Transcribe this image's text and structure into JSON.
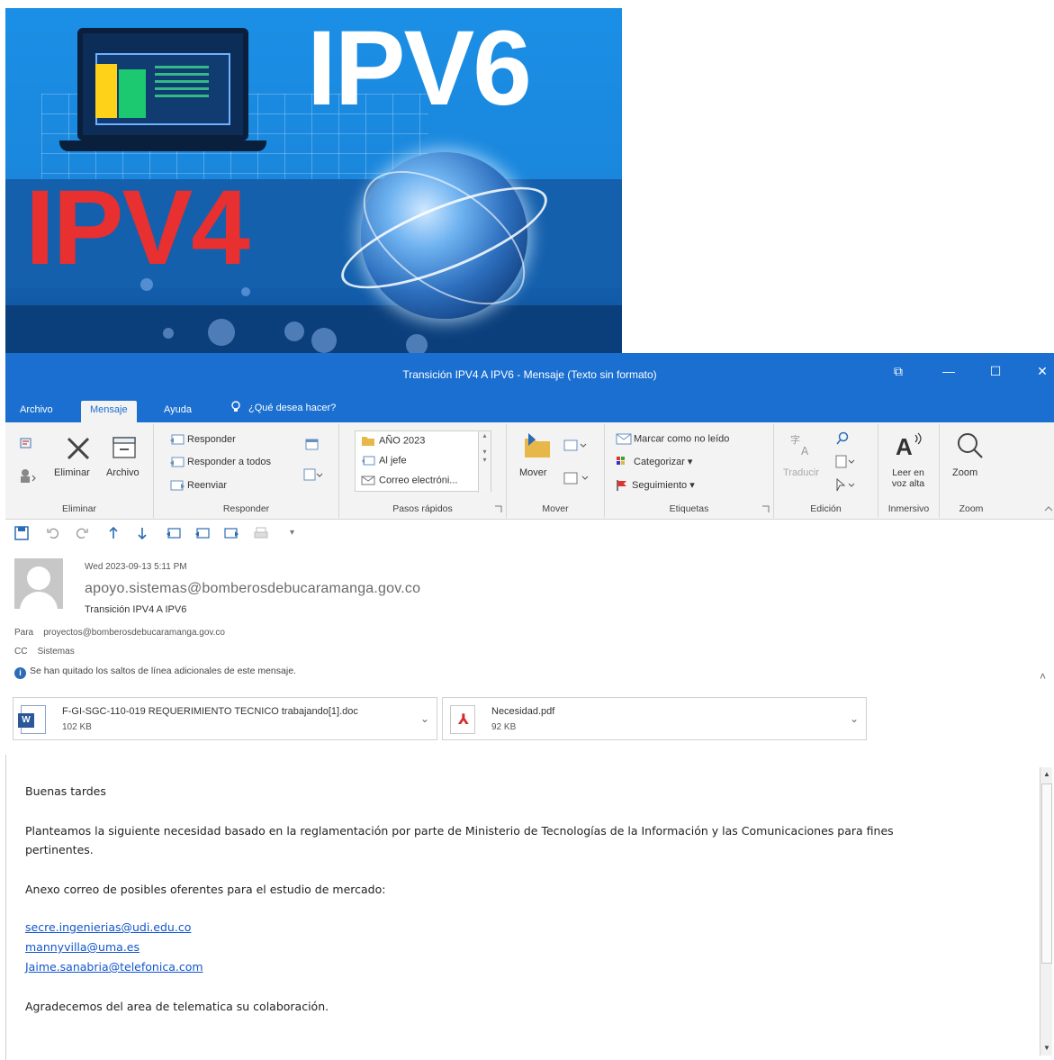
{
  "banner": {
    "text_ipv6": "IPV6",
    "text_ipv4": "IPV4"
  },
  "window": {
    "title": "Transición IPV4 A IPV6  -  Mensaje (Texto sin formato)",
    "controls": {
      "restore": "⧉",
      "minimize": "—",
      "maximize": "☐",
      "close": "✕"
    }
  },
  "tabs": [
    {
      "label": "Archivo"
    },
    {
      "label": "Mensaje"
    },
    {
      "label": "Ayuda"
    }
  ],
  "tell_me": "¿Qué desea hacer?",
  "ribbon": {
    "eliminar": {
      "delete_label": "Eliminar",
      "archive_label": "Archivo",
      "group_label": "Eliminar"
    },
    "responder": {
      "reply": "Responder",
      "reply_all": "Responder a todos",
      "forward": "Reenviar",
      "group_label": "Responder"
    },
    "pasos_rapidos": {
      "items": [
        "AÑO 2023",
        "Al jefe",
        "Correo electróni..."
      ],
      "group_label": "Pasos rápidos"
    },
    "mover": {
      "move_label": "Mover",
      "group_label": "Mover"
    },
    "etiquetas": {
      "mark_unread": "Marcar como no leído",
      "categorize": "Categorizar",
      "follow_up": "Seguimiento",
      "group_label": "Etiquetas"
    },
    "edicion": {
      "translate": "Traducir",
      "group_label": "Edición"
    },
    "inmersivo": {
      "read_aloud": "Leer en voz alta",
      "group_label": "Inmersivo"
    },
    "zoom": {
      "zoom_label": "Zoom",
      "group_label": "Zoom"
    }
  },
  "message": {
    "date": "Wed 2023-09-13 5:11 PM",
    "from": "apoyo.sistemas@bomberosdebucaramanga.gov.co",
    "subject": "Transición IPV4 A IPV6",
    "to_label": "Para",
    "to": "proyectos@bomberosdebucaramanga.gov.co",
    "cc_label": "CC",
    "cc": "Sistemas",
    "info": "Se han quitado los saltos de línea adicionales de este mensaje."
  },
  "attachments": [
    {
      "name": "F-GI-SGC-110-019 REQUERIMIENTO TECNICO trabajando[1].doc",
      "size": "102 KB",
      "type": "word"
    },
    {
      "name": "Necesidad.pdf",
      "size": "92 KB",
      "type": "pdf"
    }
  ],
  "body": {
    "greeting": "Buenas tardes",
    "paragraph1_line1": "Planteamos la siguiente necesidad basado en la reglamentación por parte de Ministerio de Tecnologías de la Información y las Comunicaciones para fines",
    "paragraph1_line2": "pertinentes.",
    "paragraph2": "Anexo correo de posibles oferentes para el estudio de mercado:",
    "links": [
      "secre.ingenierias@udi.edu.co",
      "mannyvilla@uma.es",
      "Jaime.sanabria@telefonica.com"
    ],
    "closing": "Agradecemos del area de telematica su colaboración."
  }
}
